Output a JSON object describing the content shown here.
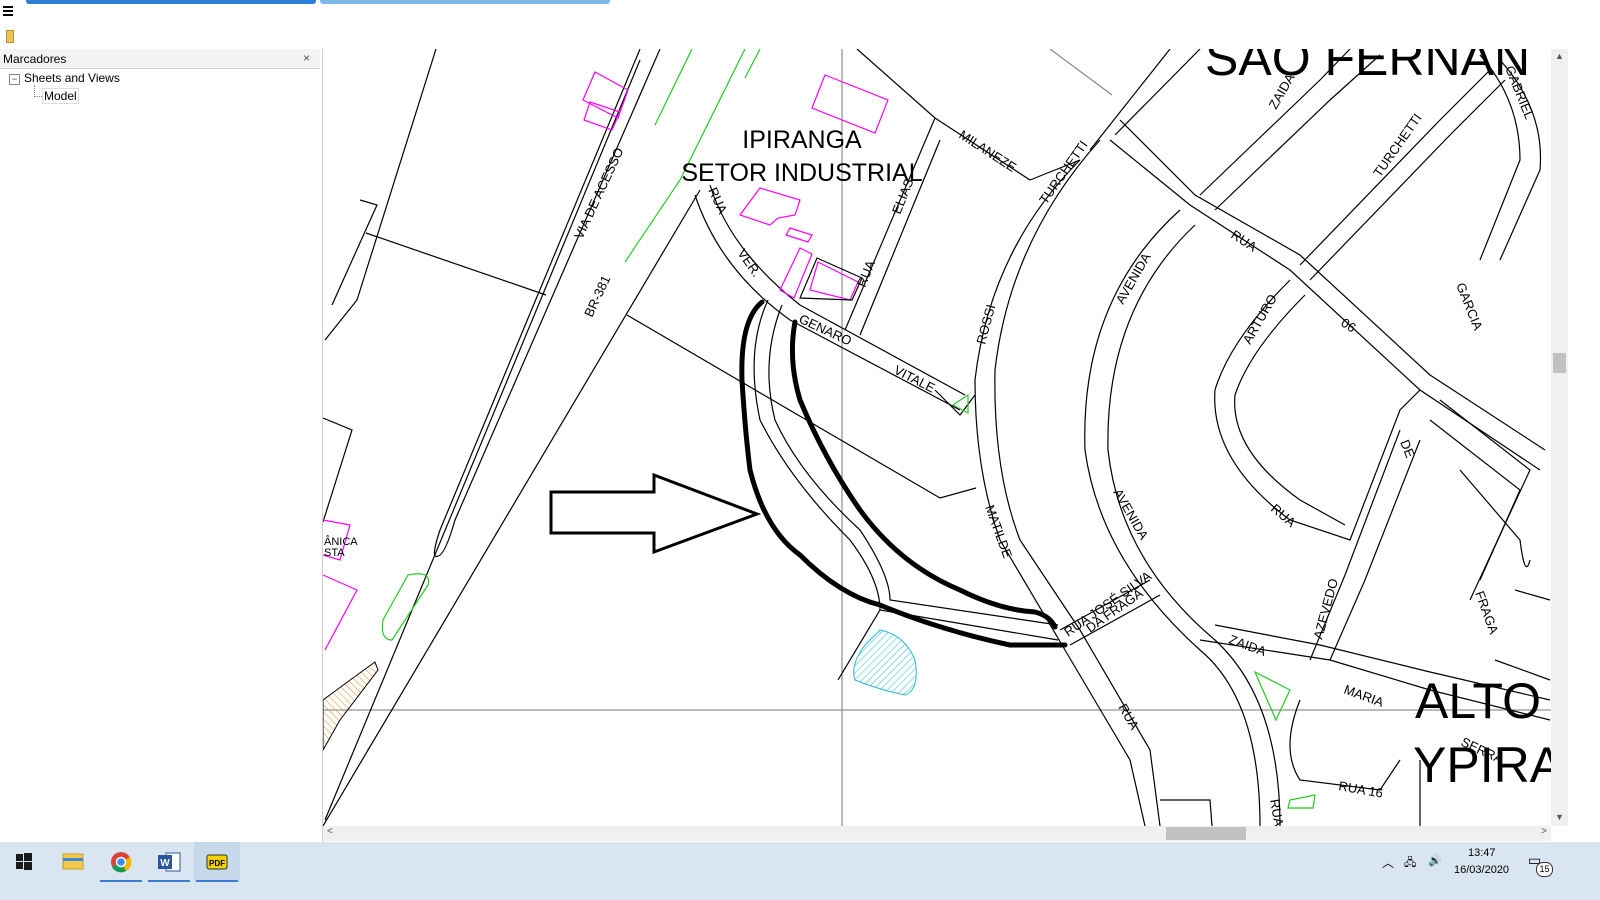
{
  "panel": {
    "title": "Marcadores",
    "close_glyph": "×",
    "tree_toggle": "−",
    "tree_root": "Sheets and Views",
    "tree_child": "Model"
  },
  "map": {
    "district1_line1": "IPIRANGA",
    "district1_line2": "SETOR INDUSTRIAL",
    "district2": "SÃO FERNAN",
    "district3_line1": "ALTO",
    "district3_line2": "YPIRA",
    "street_via_acesso": "VIA DE ACESSO",
    "street_br381": "BR-381",
    "street_rua1": "RUA",
    "street_ver": "VER.",
    "street_genaro": "GENARO",
    "street_vitale": "VITALE",
    "street_elias": "ELIAS",
    "street_rua2": "RUA",
    "street_rossi": "ROSSI",
    "street_milaneze": "MILANEZE",
    "street_turchetti": "TURCHETTI",
    "street_zaida1": "ZAIDA",
    "street_gabriel": "GABRIEL",
    "street_turchetti2": "TURCHETTI",
    "street_avenida1": "AVENIDA",
    "street_rua3": "RUA",
    "street_arturo": "ARTURO",
    "street_06": "06",
    "street_garcia": "GARCIA",
    "street_de": "DE",
    "street_rua4": "RUA",
    "street_avenida2": "AVENIDA",
    "street_matilde": "MATILDE",
    "street_jose": "RUA JOSÉ SILVA",
    "street_fraga": "DA FRAGA",
    "street_azevedo": "AZEVEDO",
    "street_fraga2": "FRAGA",
    "street_zaida2": "ZAIDA",
    "street_maria": "MARIA",
    "street_serra": "SERRA",
    "street_rua5": "RUA",
    "street_rua16": "RUA 16",
    "street_rua6": "RUA",
    "label_mecanica_1": "ÂNICA",
    "label_mecanica_2": "STA"
  },
  "taskbar": {
    "time": "13:47",
    "date": "16/03/2020",
    "notifications": "15"
  },
  "icons": {
    "start": "windows-start-icon",
    "explorer": "file-explorer-icon",
    "chrome": "chrome-icon",
    "word": "word-icon",
    "pdf": "pdf-viewer-icon"
  },
  "colors": {
    "accent": "#3a7bd5",
    "building": "#ff00ff",
    "green_feature": "#22cc22",
    "water": "#22bbcc",
    "hatch_orange": "#e08a20"
  }
}
